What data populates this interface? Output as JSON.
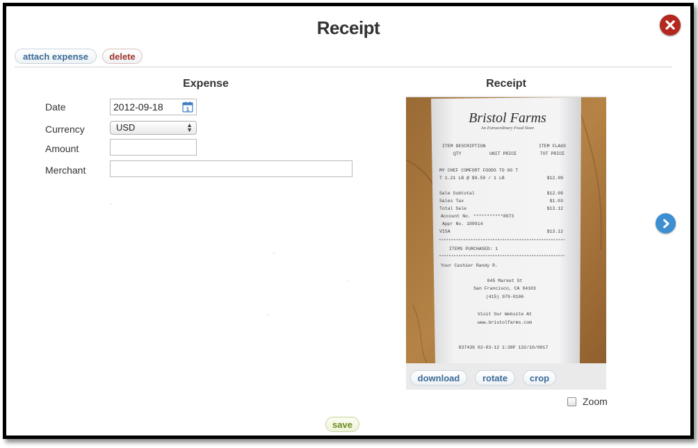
{
  "dialog": {
    "title": "Receipt"
  },
  "actions": {
    "attach_label": "attach expense",
    "delete_label": "delete",
    "save_label": "save"
  },
  "expense": {
    "heading": "Expense",
    "fields": {
      "date_label": "Date",
      "date_value": "2012-09-18",
      "calendar_day": "1",
      "currency_label": "Currency",
      "currency_value": "USD",
      "amount_label": "Amount",
      "amount_value": "",
      "merchant_label": "Merchant",
      "merchant_value": ""
    }
  },
  "receipt": {
    "heading": "Receipt",
    "toolbar": {
      "download_label": "download",
      "rotate_label": "rotate",
      "crop_label": "crop"
    },
    "zoom_label": "Zoom",
    "zoom_checked": false,
    "image": {
      "store_name": "Bristol Farms",
      "store_tagline": "An Extraordinary Food Store",
      "columns_row1_left": "ITEM DESCRIPTION",
      "columns_row1_right": "ITEM FLAGS",
      "columns_row2_qty": "QTY",
      "columns_row2_unit": "UNIT PRICE",
      "columns_row2_total": "TOT PRICE",
      "item_line1": "MY CHEF COMFORT FOODS TO GO T",
      "item_line2": "T  1.21 LB  @  $9.59 / 1 LB",
      "item_price": "$12.09",
      "sale_subtotal_label": "Sale Subtotal",
      "sale_subtotal_value": "$12.09",
      "sales_tax_label": "Sales Tax",
      "sales_tax_value": "$1.03",
      "total_sale_label": "Total Sale",
      "total_sale_value": "$13.12",
      "account_no": "Account No. ***********8073",
      "appr_no": "Appr No. 100914",
      "visa_label": "VISA",
      "visa_value": "$13.12",
      "items_purchased": "ITEMS PURCHASED: 1",
      "cashier": "Your Cashier Randy R.",
      "address_line1": "845 Market St",
      "address_line2": "San Francisco, CA 94103",
      "phone": "(415) 979-0106",
      "website_line1": "Visit Our Website At",
      "website_line2": "www.bristolfarms.com",
      "footer_code": "837436 02-03-12  1:38P 132/10/0017"
    }
  },
  "icons": {
    "close": "close-circle-icon",
    "calendar": "calendar-icon",
    "next": "chevron-right-circle-icon",
    "select_arrows": "select-arrows-icon"
  },
  "colors": {
    "close_button": "#b3271f",
    "next_button": "#3d8fd1",
    "link_blue": "#3a6b97",
    "delete_red": "#a33329",
    "save_green": "#6b8a1f"
  }
}
